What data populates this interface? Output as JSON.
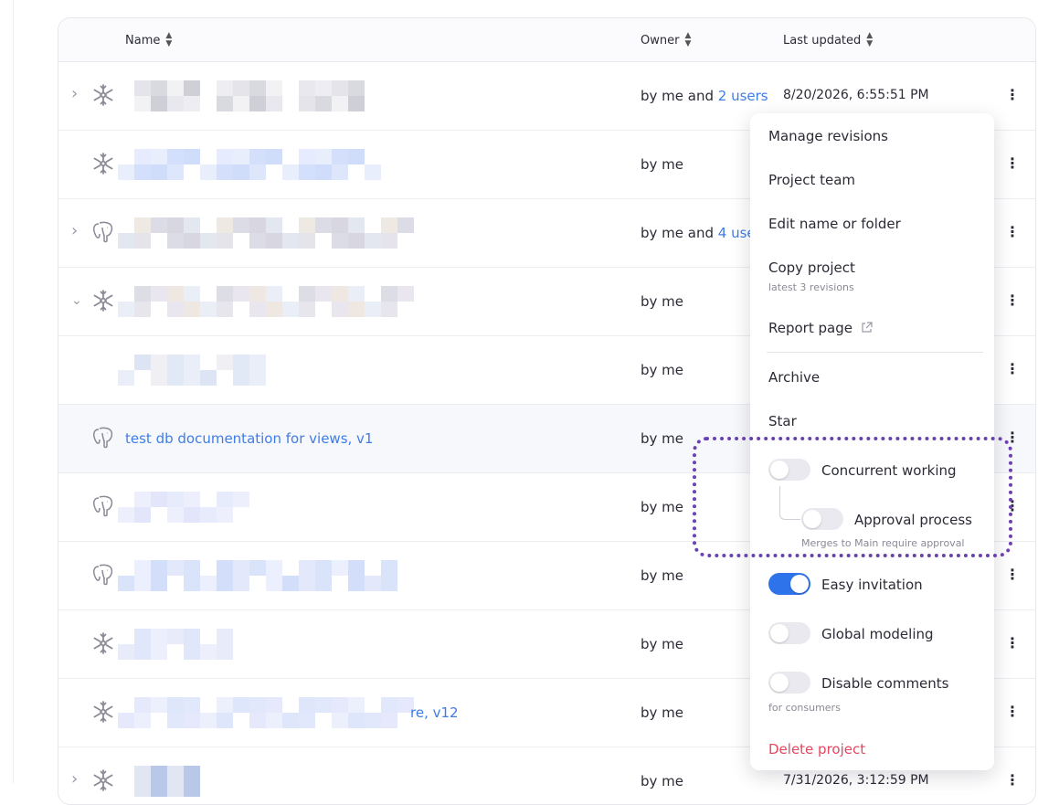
{
  "table": {
    "headers": {
      "name": "Name",
      "owner": "Owner",
      "last_updated": "Last updated"
    },
    "rows": [
      {
        "name": "",
        "owner": "by me and ",
        "owner_link": "2 users",
        "date": "8/20/2026, 6:55:51 PM",
        "icon": "snowflake-icon",
        "expand": "collapsed"
      },
      {
        "name": "",
        "owner": "by me",
        "owner_link": "",
        "date": "",
        "icon": "snowflake-icon",
        "expand": "none"
      },
      {
        "name": "",
        "owner": "by me and ",
        "owner_link": "4 use",
        "date": "",
        "icon": "postgres-elephant-icon",
        "expand": "collapsed"
      },
      {
        "name": "",
        "owner": "by me",
        "owner_link": "",
        "date": "",
        "icon": "snowflake-icon",
        "expand": "expanded"
      },
      {
        "name": "",
        "owner": "by me",
        "owner_link": "",
        "date": "",
        "icon": "",
        "expand": "none"
      },
      {
        "name": "test db documentation for views, v1",
        "owner": "by me",
        "owner_link": "",
        "date": "",
        "icon": "postgres-elephant-icon",
        "expand": "none"
      },
      {
        "name": "",
        "owner": "by me",
        "owner_link": "",
        "date": "",
        "icon": "postgres-elephant-icon",
        "expand": "none"
      },
      {
        "name": "",
        "owner": "by me",
        "owner_link": "",
        "date": "",
        "icon": "postgres-elephant-icon",
        "expand": "none"
      },
      {
        "name": "",
        "owner": "by me",
        "owner_link": "",
        "date": "",
        "icon": "snowflake-icon",
        "expand": "none"
      },
      {
        "name": "re, v12",
        "owner": "by me",
        "owner_link": "",
        "date": "",
        "icon": "snowflake-icon",
        "expand": "none"
      },
      {
        "name": "",
        "owner": "by me",
        "owner_link": "",
        "date": "7/31/2026, 3:12:59 PM",
        "icon": "snowflake-icon",
        "expand": "collapsed"
      }
    ]
  },
  "menu": {
    "manage_revisions": "Manage revisions",
    "project_team": "Project team",
    "edit_name": "Edit name or folder",
    "copy_project": "Copy project",
    "copy_project_sub": "latest 3 revisions",
    "report_page": "Report page",
    "archive": "Archive",
    "star": "Star",
    "concurrent_working": "Concurrent working",
    "approval_process": "Approval process",
    "approval_sub": "Merges to Main require approval",
    "easy_invitation": "Easy invitation",
    "global_modeling": "Global modeling",
    "disable_comments": "Disable comments",
    "disable_comments_sub": "for consumers",
    "delete_project": "Delete project",
    "toggles": {
      "concurrent_working": false,
      "approval_process": false,
      "easy_invitation": true,
      "global_modeling": false,
      "disable_comments": false
    }
  },
  "colors": {
    "link": "#3f7de6",
    "toggle_on": "#2f73ea",
    "delete": "#e5475f",
    "highlight_border": "#6a40b3"
  }
}
